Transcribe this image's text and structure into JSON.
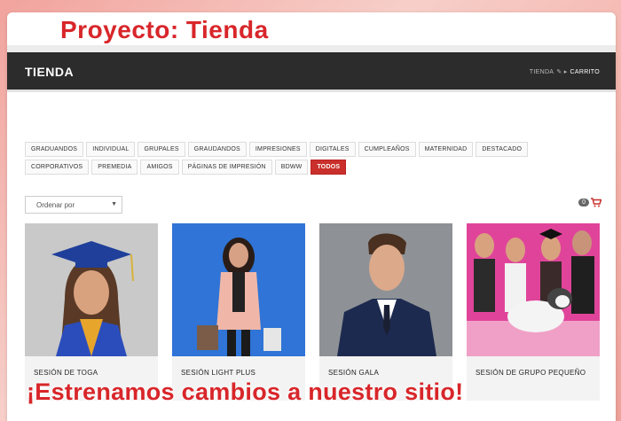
{
  "project_title": "Proyecto: Tienda",
  "header": {
    "brand": "TIENDA",
    "breadcrumb": {
      "home": "TIENDA",
      "current": "CARRITO"
    }
  },
  "filters": [
    {
      "label": "GRADUANDOS",
      "active": false
    },
    {
      "label": "INDIVIDUAL",
      "active": false
    },
    {
      "label": "GRUPALES",
      "active": false
    },
    {
      "label": "GRAUDANDOS",
      "active": false
    },
    {
      "label": "IMPRESIONES",
      "active": false
    },
    {
      "label": "DIGITALES",
      "active": false
    },
    {
      "label": "CUMPLEAÑOS",
      "active": false
    },
    {
      "label": "MATERNIDAD",
      "active": false
    },
    {
      "label": "DESTACADO",
      "active": false
    },
    {
      "label": "CORPORATIVOS",
      "active": false
    },
    {
      "label": "PREMEDIA",
      "active": false
    },
    {
      "label": "AMIGOS",
      "active": false
    },
    {
      "label": "PÁGINAS DE IMPRESIÓN",
      "active": false
    },
    {
      "label": "BDWW",
      "active": false
    },
    {
      "label": "TODOS",
      "active": true
    }
  ],
  "sort": {
    "selected": "Ordenar por"
  },
  "cart": {
    "count": "0",
    "icon": "cart-icon",
    "color": "#c9302c"
  },
  "products": [
    {
      "name": "SESIÓN DE TOGA",
      "photo": "graduate-photo"
    },
    {
      "name": "SESIÓN LIGHT PLUS",
      "photo": "woman-shopping-photo"
    },
    {
      "name": "SESIÓN GALA",
      "photo": "man-suit-photo"
    },
    {
      "name": "SESIÓN DE GRUPO PEQUEÑO",
      "photo": "group-with-dog-photo"
    }
  ],
  "banner": "¡Estrenamos cambios a nuestro sitio!",
  "colors": {
    "accent": "#d8262a",
    "topbar": "#2c2c2c"
  }
}
